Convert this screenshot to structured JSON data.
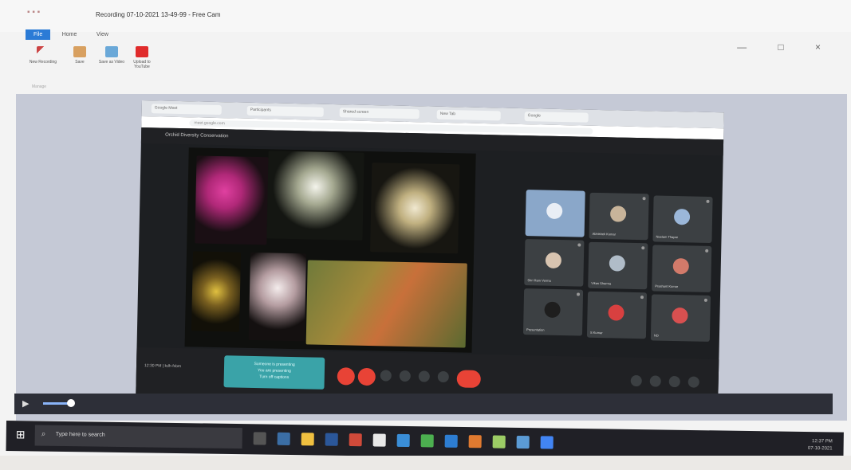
{
  "window": {
    "title": "Recording 07-10-2021 13-49-99 - Free Cam",
    "controls": "— □ ×"
  },
  "ribbon": {
    "tabs": [
      "File",
      "Home",
      "View"
    ],
    "buttons": [
      "New Recording",
      "Save",
      "Save as Video",
      "Upload to YouTube"
    ],
    "group_label": "Manage"
  },
  "browser": {
    "tabs": [
      "Google Meet",
      "Participants",
      "Shared screen",
      "New Tab",
      "Google"
    ],
    "address": "meet.google.com"
  },
  "meeting": {
    "title": "Orchid Diversity Conservation",
    "clock": "12:30 PM  |  kdh-fxbm",
    "caption": [
      "Someone is presenting",
      "You are presenting",
      "Turn off captions"
    ],
    "participants": [
      {
        "name": "",
        "color": "#8aa7c9"
      },
      {
        "name": "Abhishek Kumar",
        "color": "#c8b49a"
      },
      {
        "name": "Neelam Thapar",
        "color": "#9bb7d9"
      },
      {
        "name": "Shri Ram Verma",
        "color": "#d8c4b0"
      },
      {
        "name": "Vikas Sharma",
        "color": "#b0bcc8"
      },
      {
        "name": "Prashant Kumar",
        "color": "#d27a6a"
      },
      {
        "name": "Presentation",
        "color": "#2a2a2a"
      },
      {
        "name": "S Kumar",
        "color": "#d84040"
      },
      {
        "name": "ND",
        "color": "#d85050"
      }
    ]
  },
  "player": {
    "play_icon": "▶"
  },
  "taskbar": {
    "search_placeholder": "Type here to search",
    "tray": [
      "12:37 PM",
      "07-10-2021"
    ]
  },
  "colors": {
    "accent": "#2b7bd6",
    "end_call": "#e84336",
    "caption_bg": "#3aa3a8"
  }
}
